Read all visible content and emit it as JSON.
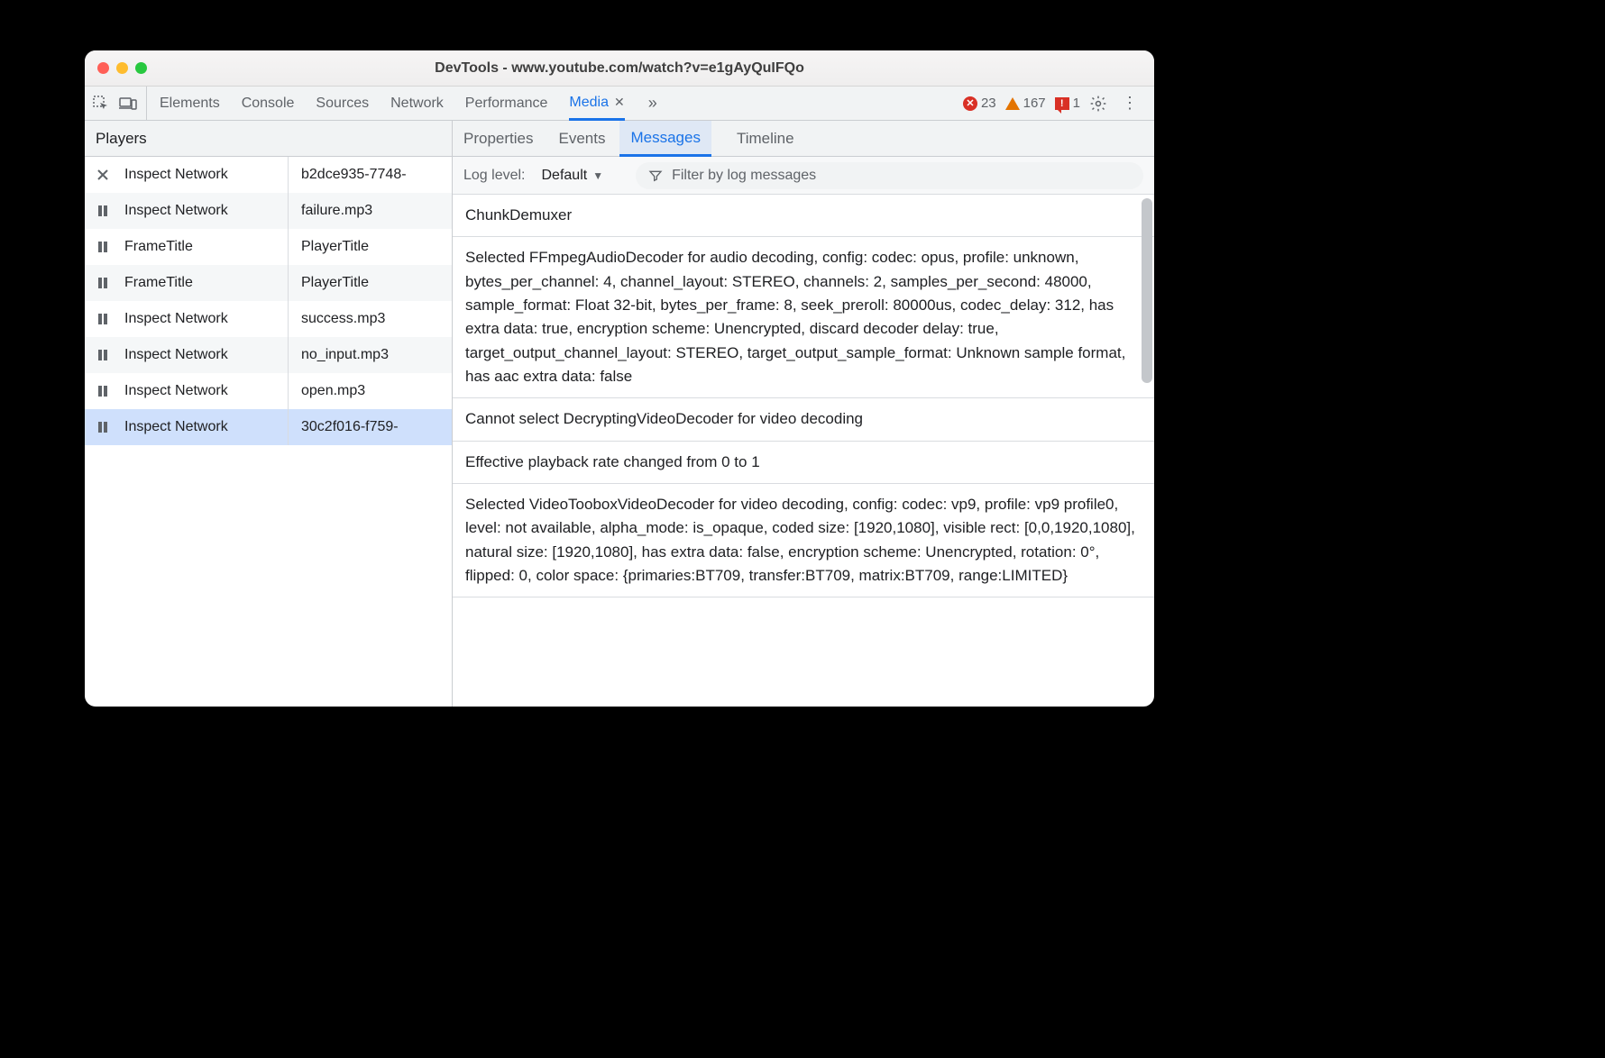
{
  "window": {
    "title": "DevTools - www.youtube.com/watch?v=e1gAyQuIFQo"
  },
  "tabs": {
    "items": [
      "Elements",
      "Console",
      "Sources",
      "Network",
      "Performance",
      "Media"
    ],
    "active": "Media"
  },
  "status": {
    "errors": "23",
    "warnings": "167",
    "issues": "1"
  },
  "sidebar": {
    "header": "Players",
    "rows": [
      {
        "icon": "x",
        "col1": "Inspect Network",
        "col2": "b2dce935-7748-"
      },
      {
        "icon": "pause",
        "col1": "Inspect Network",
        "col2": "failure.mp3"
      },
      {
        "icon": "pause",
        "col1": "FrameTitle",
        "col2": "PlayerTitle"
      },
      {
        "icon": "pause",
        "col1": "FrameTitle",
        "col2": "PlayerTitle"
      },
      {
        "icon": "pause",
        "col1": "Inspect Network",
        "col2": "success.mp3"
      },
      {
        "icon": "pause",
        "col1": "Inspect Network",
        "col2": "no_input.mp3"
      },
      {
        "icon": "pause",
        "col1": "Inspect Network",
        "col2": "open.mp3"
      },
      {
        "icon": "pause",
        "col1": "Inspect Network",
        "col2": "30c2f016-f759-",
        "selected": true
      }
    ]
  },
  "subtabs": {
    "items": [
      "Properties",
      "Events",
      "Messages",
      "Timeline"
    ],
    "active": "Messages"
  },
  "filter": {
    "label": "Log level:",
    "default": "Default",
    "placeholder": "Filter by log messages"
  },
  "messages": [
    "ChunkDemuxer",
    "Selected FFmpegAudioDecoder for audio decoding, config: codec: opus, profile: unknown, bytes_per_channel: 4, channel_layout: STEREO, channels: 2, samples_per_second: 48000, sample_format: Float 32-bit, bytes_per_frame: 8, seek_preroll: 80000us, codec_delay: 312, has extra data: true, encryption scheme: Unencrypted, discard decoder delay: true, target_output_channel_layout: STEREO, target_output_sample_format: Unknown sample format, has aac extra data: false",
    "Cannot select DecryptingVideoDecoder for video decoding",
    "Effective playback rate changed from 0 to 1",
    "Selected VideoTooboxVideoDecoder for video decoding, config: codec: vp9, profile: vp9 profile0, level: not available, alpha_mode: is_opaque, coded size: [1920,1080], visible rect: [0,0,1920,1080], natural size: [1920,1080], has extra data: false, encryption scheme: Unencrypted, rotation: 0°, flipped: 0, color space: {primaries:BT709, transfer:BT709, matrix:BT709, range:LIMITED}"
  ]
}
